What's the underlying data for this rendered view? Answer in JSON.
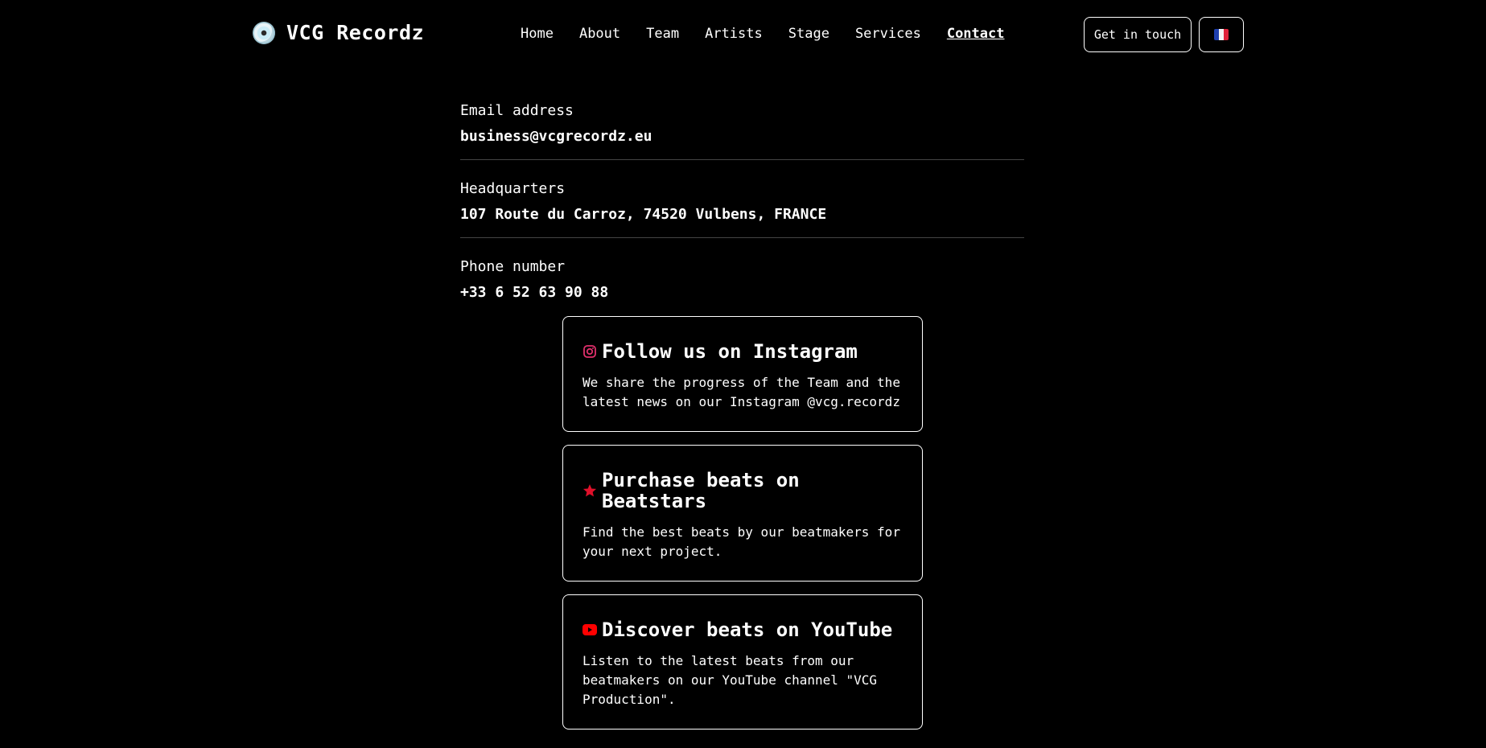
{
  "header": {
    "brand": "VCG Recordz",
    "nav": [
      "Home",
      "About",
      "Team",
      "Artists",
      "Stage",
      "Services",
      "Contact"
    ],
    "active_nav": "Contact",
    "cta_label": "Get in touch",
    "language_flag": "fr"
  },
  "contact": {
    "email": {
      "label": "Email address",
      "value": "business@vcgrecordz.eu"
    },
    "hq": {
      "label": "Headquarters",
      "value": "107 Route du Carroz, 74520 Vulbens, FRANCE"
    },
    "phone": {
      "label": "Phone number",
      "value": "+33 6 52 63 90 88"
    }
  },
  "cards": {
    "instagram": {
      "title": "Follow us on Instagram",
      "desc": "We share the progress of the Team and the latest news on our Instagram @vcg.recordz",
      "icon": "instagram-icon",
      "color": "#e1306c"
    },
    "beatstars": {
      "title": "Purchase beats on Beatstars",
      "desc": "Find the best beats by our beatmakers for your next project.",
      "icon": "star-icon",
      "color": "#e0102a"
    },
    "youtube": {
      "title": "Discover beats on YouTube",
      "desc": "Listen to the latest beats from our beatmakers on our YouTube channel \"VCG Production\".",
      "icon": "youtube-icon",
      "color": "#ff0000"
    }
  }
}
